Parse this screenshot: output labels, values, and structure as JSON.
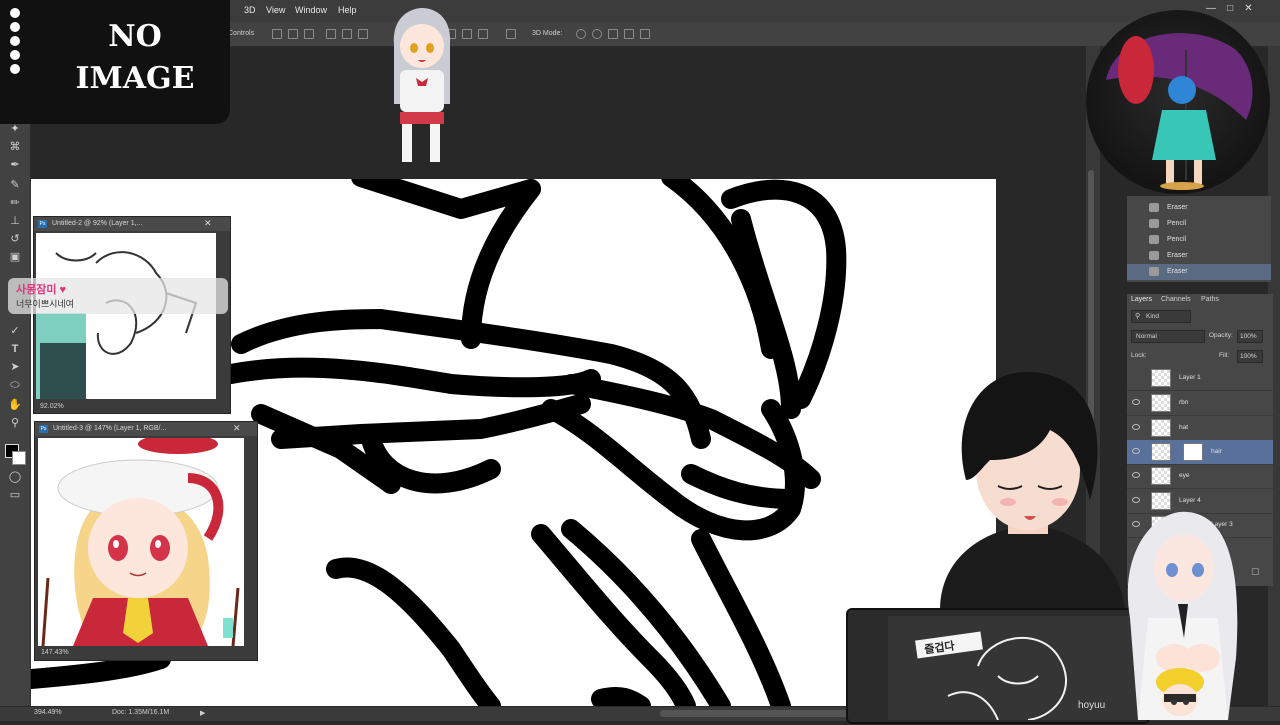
{
  "menubar": {
    "items": [
      "3D",
      "View",
      "Window",
      "Help"
    ]
  },
  "optionsbar": {
    "controls_label": "Controls",
    "mode_label": "3D Mode:"
  },
  "tools": {
    "icons": [
      "magic-wand-icon",
      "crop-icon",
      "eyedropper-icon",
      "brush-icon",
      "pencil-icon",
      "stamp-icon",
      "eraser-icon",
      "pen-icon",
      "type-icon",
      "path-select-icon",
      "shape-icon",
      "hand-icon",
      "zoom-icon",
      "colors-icon",
      "quickmask-icon",
      "screenmode-icon"
    ]
  },
  "overlay": {
    "no_image_line1": "NO",
    "no_image_line2": "IMAGE",
    "chat_name": "사몽잠미 ♥",
    "chat_message": "너무이쁘시네여"
  },
  "doc1": {
    "title": "Untitled-2 @ 92% (Layer 1,...",
    "zoom": "92.02%"
  },
  "doc2": {
    "title": "Untitled-3 @ 147% (Layer 1, RGB/...",
    "zoom": "147.43%"
  },
  "history": {
    "items": [
      {
        "label": "Eraser"
      },
      {
        "label": "Pencil"
      },
      {
        "label": "Pencil"
      },
      {
        "label": "Eraser"
      },
      {
        "label": "Eraser"
      }
    ]
  },
  "layers": {
    "tabs": [
      "Layers",
      "Channels",
      "Paths"
    ],
    "kind_label": "Kind",
    "blend_mode": "Normal",
    "opacity_label": "Opacity:",
    "opacity_value": "100%",
    "lock_label": "Lock:",
    "fill_label": "Fill:",
    "fill_value": "100%",
    "items": [
      {
        "name": "Layer 1"
      },
      {
        "name": "rbn"
      },
      {
        "name": "hat"
      },
      {
        "name": "hair"
      },
      {
        "name": "eye"
      },
      {
        "name": "Layer 4"
      },
      {
        "name": "Layer 3"
      }
    ]
  },
  "status": {
    "zoom": "394.49%",
    "doc_size": "Doc: 1.35M/16.1M"
  },
  "tablet": {
    "sticker_text": "즐겁다",
    "brand": "hoyuu"
  },
  "colors": {
    "selected_layer": "#58709a",
    "accent_pink": "#e0387f"
  }
}
